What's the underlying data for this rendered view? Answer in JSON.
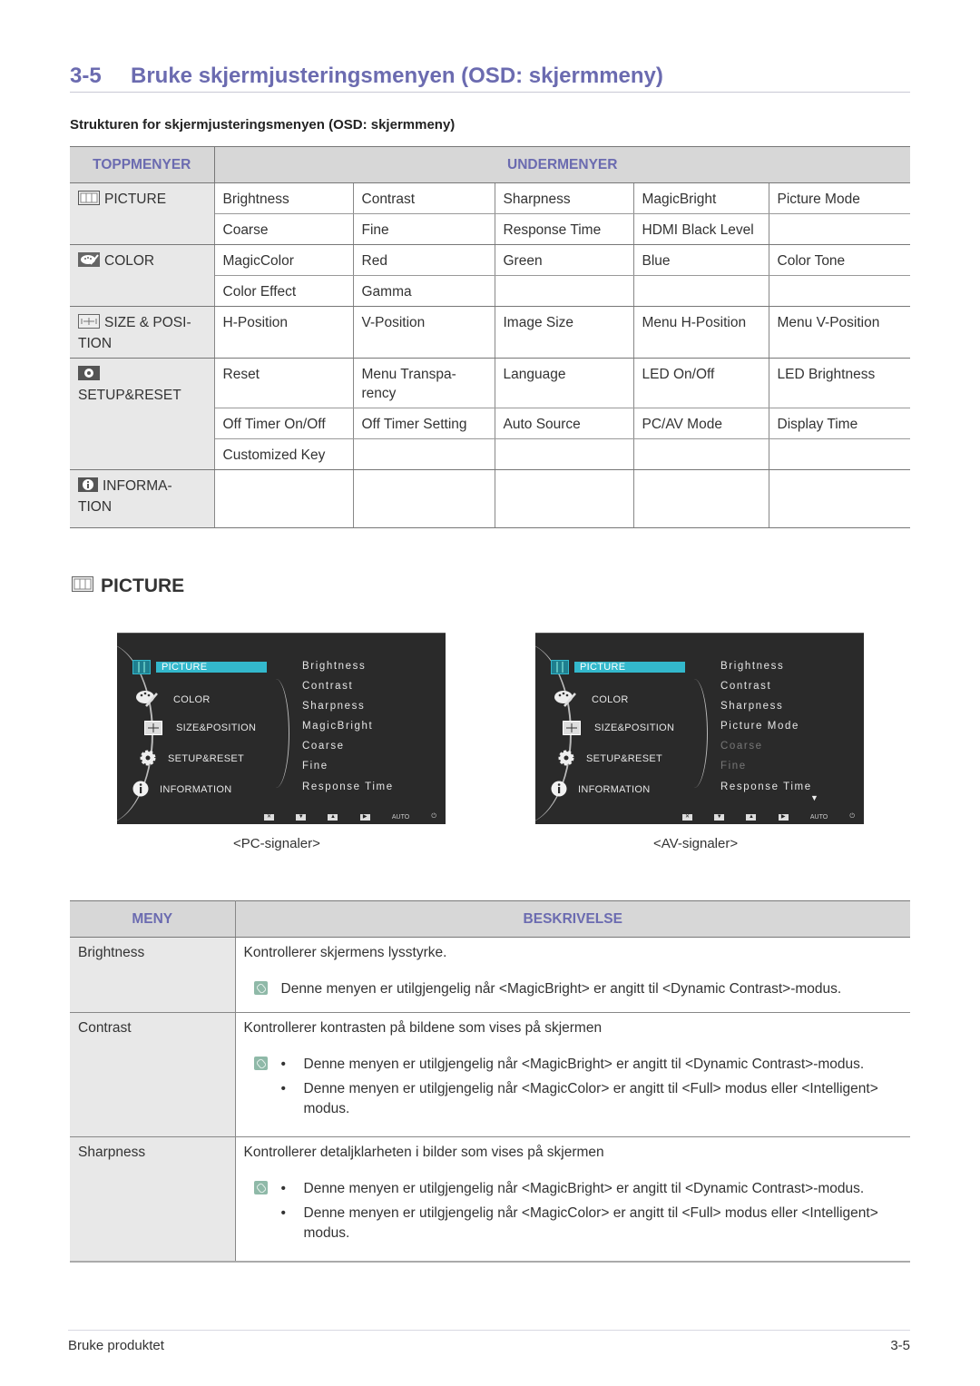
{
  "heading": {
    "number": "3-5",
    "title": "Bruke skjermjusteringsmenyen (OSD: skjermmeny)"
  },
  "subheading": "Strukturen for skjermjusteringsmenyen (OSD: skjermmeny)",
  "structure_table": {
    "headers": {
      "top_menus": "TOPPMENYER",
      "submenus": "UNDERMENYER"
    },
    "groups": [
      {
        "icon": "picture-icon",
        "label": "PICTURE",
        "rows": [
          [
            "Brightness",
            "Contrast",
            "Sharpness",
            "MagicBright",
            "Picture Mode"
          ],
          [
            "Coarse",
            "Fine",
            "Response Time",
            "HDMI Black Level",
            ""
          ]
        ]
      },
      {
        "icon": "color-palette-icon",
        "label": "COLOR",
        "rows": [
          [
            "MagicColor",
            "Red",
            "Green",
            "Blue",
            "Color Tone"
          ],
          [
            "Color Effect",
            "Gamma",
            "",
            "",
            ""
          ]
        ]
      },
      {
        "icon": "size-position-icon",
        "label": "SIZE & POSI-TION",
        "rows": [
          [
            "H-Position",
            "V-Position",
            "Image Size",
            "Menu H-Position",
            "Menu V-Position"
          ]
        ]
      },
      {
        "icon": "setup-gear-icon",
        "label": "SETUP&RESET",
        "rows": [
          [
            "Reset",
            "Menu Transpa-rency",
            "Language",
            "LED On/Off",
            "LED Brightness"
          ],
          [
            "Off Timer On/Off",
            "Off Timer Setting",
            "Auto Source",
            "PC/AV Mode",
            "Display Time"
          ],
          [
            "Customized Key",
            "",
            "",
            "",
            ""
          ]
        ]
      },
      {
        "icon": "information-icon",
        "label": "INFORMA-TION",
        "rows": [
          [
            "",
            "",
            "",
            "",
            ""
          ]
        ]
      }
    ]
  },
  "section": {
    "icon": "picture-icon",
    "title": "PICTURE"
  },
  "osd_screens": [
    {
      "caption": "<PC-signaler>",
      "main_menu": [
        "PICTURE",
        "COLOR",
        "SIZE&POSITION",
        "SETUP&RESET",
        "INFORMATION"
      ],
      "selected": "PICTURE",
      "submenu": [
        {
          "label": "Brightness",
          "enabled": true
        },
        {
          "label": "Contrast",
          "enabled": true
        },
        {
          "label": "Sharpness",
          "enabled": true
        },
        {
          "label": "MagicBright",
          "enabled": true
        },
        {
          "label": "Coarse",
          "enabled": true
        },
        {
          "label": "Fine",
          "enabled": true
        },
        {
          "label": "Response Time",
          "enabled": true
        }
      ],
      "more_indicator": false,
      "buttons": [
        "exit",
        "down",
        "up",
        "enter",
        "AUTO",
        "power"
      ]
    },
    {
      "caption": "<AV-signaler>",
      "main_menu": [
        "PICTURE",
        "COLOR",
        "SIZE&POSITION",
        "SETUP&RESET",
        "INFORMATION"
      ],
      "selected": "PICTURE",
      "submenu": [
        {
          "label": "Brightness",
          "enabled": true
        },
        {
          "label": "Contrast",
          "enabled": true
        },
        {
          "label": "Sharpness",
          "enabled": true
        },
        {
          "label": "Picture Mode",
          "enabled": true
        },
        {
          "label": "Coarse",
          "enabled": false
        },
        {
          "label": "Fine",
          "enabled": false
        },
        {
          "label": "Response Time",
          "enabled": true
        }
      ],
      "more_indicator": true,
      "buttons": [
        "exit",
        "down",
        "up",
        "enter",
        "AUTO",
        "power"
      ]
    }
  ],
  "description_table": {
    "headers": {
      "menu": "MENY",
      "description": "BESKRIVELSE"
    },
    "rows": [
      {
        "menu": "Brightness",
        "lead": "Kontrollerer skjermens lysstyrke.",
        "notes": [
          "Denne menyen er utilgjengelig når <MagicBright> er angitt til <Dynamic Contrast>-modus."
        ],
        "bulleted": false
      },
      {
        "menu": "Contrast",
        "lead": "Kontrollerer kontrasten på bildene som vises på skjermen",
        "notes": [
          "Denne menyen er utilgjengelig når <MagicBright> er angitt til <Dynamic Contrast>-modus.",
          "Denne menyen er utilgjengelig når <MagicColor> er angitt til <Full> modus eller <Intelligent> modus."
        ],
        "bulleted": true
      },
      {
        "menu": "Sharpness",
        "lead": "Kontrollerer detaljklarheten i bilder som vises på skjermen",
        "notes": [
          "Denne menyen er utilgjengelig når <MagicBright> er angitt til <Dynamic Contrast>-modus.",
          "Denne menyen er utilgjengelig når <MagicColor> er angitt til <Full> modus eller <Intelligent> modus."
        ],
        "bulleted": true
      }
    ]
  },
  "footer": {
    "left": "Bruke produktet",
    "right": "3-5"
  },
  "colors": {
    "accent": "#6b6bb0",
    "header_bg": "#d7d7d7",
    "menu_cell_bg": "#e8e8e8",
    "osd_bg": "#2a2a2a",
    "osd_select": "#33b8cc",
    "note_icon": "#8fb9a8"
  }
}
